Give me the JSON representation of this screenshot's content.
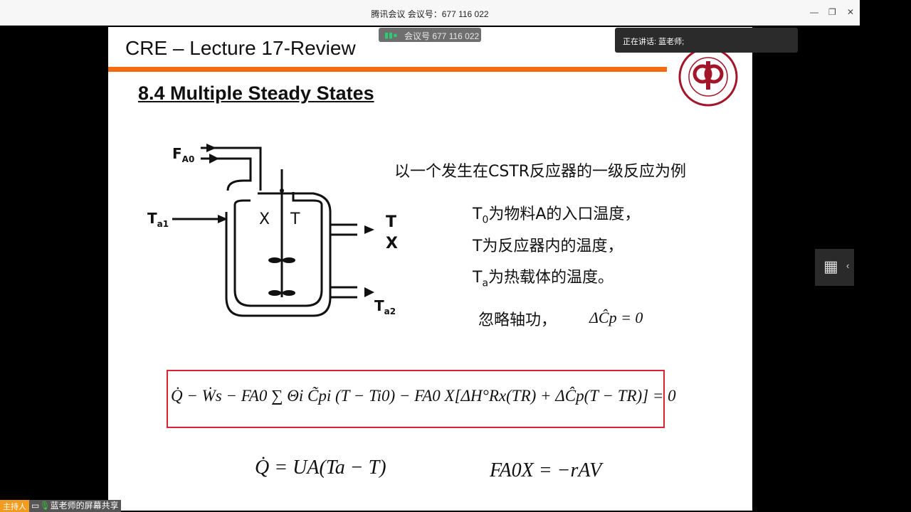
{
  "window": {
    "title": "腾讯会议 会议号：677 116 022",
    "controls": [
      "minimize-icon",
      "restore-icon",
      "close-icon"
    ]
  },
  "meeting_badge": {
    "text": "会议号 677 116 022",
    "signal_color": "#2ecc71"
  },
  "speaking": {
    "text": "正在讲话: 蓝老师;"
  },
  "share_label": {
    "role": "主持人",
    "text": "蓝老师的屏幕共享"
  },
  "slide": {
    "header": "CRE – Lecture 17-Review",
    "section": "8.4 Multiple Steady States",
    "accent": "#f26b10",
    "diagram_labels": {
      "fa0": "F",
      "fa0_sub": "A0",
      "ta1": "T",
      "ta1_sub": "a1",
      "x": "X",
      "t": "T",
      "out_t": "T",
      "out_x": "X",
      "ta2": "T",
      "ta2_sub": "a2"
    },
    "intro": "以一个发生在CSTR反应器的一级反应为例",
    "line1_pre": "T",
    "line1_sub": "0",
    "line1": "为物料A的入口温度，",
    "line2": "T为反应器内的温度，",
    "line3_pre": "T",
    "line3_sub": "a",
    "line3": "为热载体的温度。",
    "ignore": "忽略轴功，",
    "eq_cp": "ΔĈp = 0",
    "energy_balance": "Q̇ − Ẇs − FA0 ∑ Θi C̃pi (T − Ti0) − FA0 X[ΔH°Rx(TR) + ΔĈp(T − TR)] = 0",
    "eq_q": "Q̇ = UA(Ta − T)",
    "eq_fa": "FA0X = −rAV"
  }
}
